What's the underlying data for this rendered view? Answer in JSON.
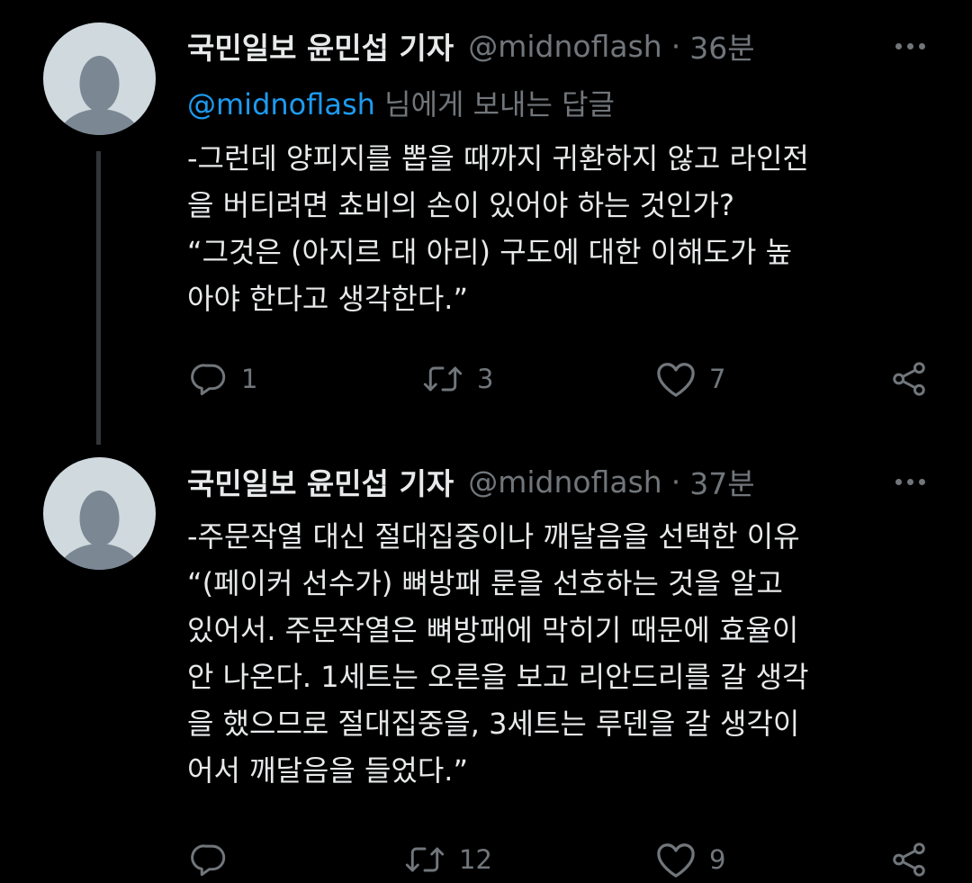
{
  "thread": {
    "tweets": [
      {
        "author_name": "국민일보 윤민섭 기자",
        "handle": "@midnoflash",
        "separator": "·",
        "time": "36분",
        "reply_mention": "@midnoflash",
        "reply_suffix": " 님에게 보내는 답글",
        "lines": [
          "-그런데 양피지를 뽑을 때까지 귀환하지 않고 라인전",
          "을 버티려면 쵸비의 손이 있어야 하는 것인가?",
          "“그것은 (아지르 대 아리) 구도에 대한 이해도가 높",
          "아야 한다고 생각한다.”"
        ],
        "reply_count": "1",
        "retweet_count": "3",
        "like_count": "7"
      },
      {
        "author_name": "국민일보 윤민섭 기자",
        "handle": "@midnoflash",
        "separator": "·",
        "time": "37분",
        "lines": [
          "-주문작열 대신 절대집중이나 깨달음을 선택한 이유",
          "“(페이커 선수가) 뼈방패 룬을 선호하는 것을 알고",
          "있어서. 주문작열은 뼈방패에 막히기 때문에 효율이",
          "안 나온다. 1세트는 오른을 보고 리안드리를 갈 생각",
          "을 했으므로 절대집중을, 3세트는 루덴을 갈 생각이",
          "어서 깨달음을 들었다.”"
        ],
        "reply_count": "",
        "retweet_count": "12",
        "like_count": "9"
      }
    ]
  },
  "icons": {
    "avatar": "default-profile-icon",
    "more": "more-dots-icon",
    "reply": "reply-bubble-icon",
    "retweet": "retweet-icon",
    "like": "heart-icon",
    "share": "share-icon"
  },
  "colors": {
    "background": "#000000",
    "text": "#e7e9ea",
    "muted": "#71767b",
    "mention": "#1d9bf0",
    "avatar_bg": "#cfd9de",
    "avatar_fg": "#7b8793"
  }
}
